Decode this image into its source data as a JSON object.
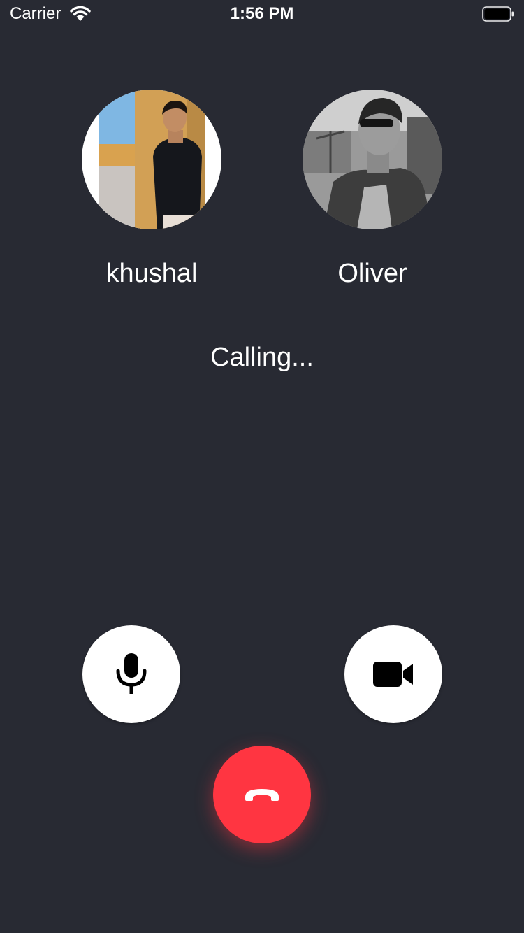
{
  "status_bar": {
    "carrier": "Carrier",
    "time": "1:56 PM",
    "wifi_icon": "wifi-icon",
    "battery_icon": "battery-full-icon"
  },
  "participants": [
    {
      "name": "khushal",
      "avatar": "user-photo-avatar"
    },
    {
      "name": "Oliver",
      "avatar": "user-photo-avatar"
    }
  ],
  "call": {
    "status": "Calling..."
  },
  "controls": {
    "mute_icon": "microphone-icon",
    "video_icon": "video-camera-icon",
    "end_call_icon": "phone-hangup-icon"
  },
  "colors": {
    "background": "#282a33",
    "end_call": "#ff3541",
    "control_bg": "#ffffff"
  }
}
